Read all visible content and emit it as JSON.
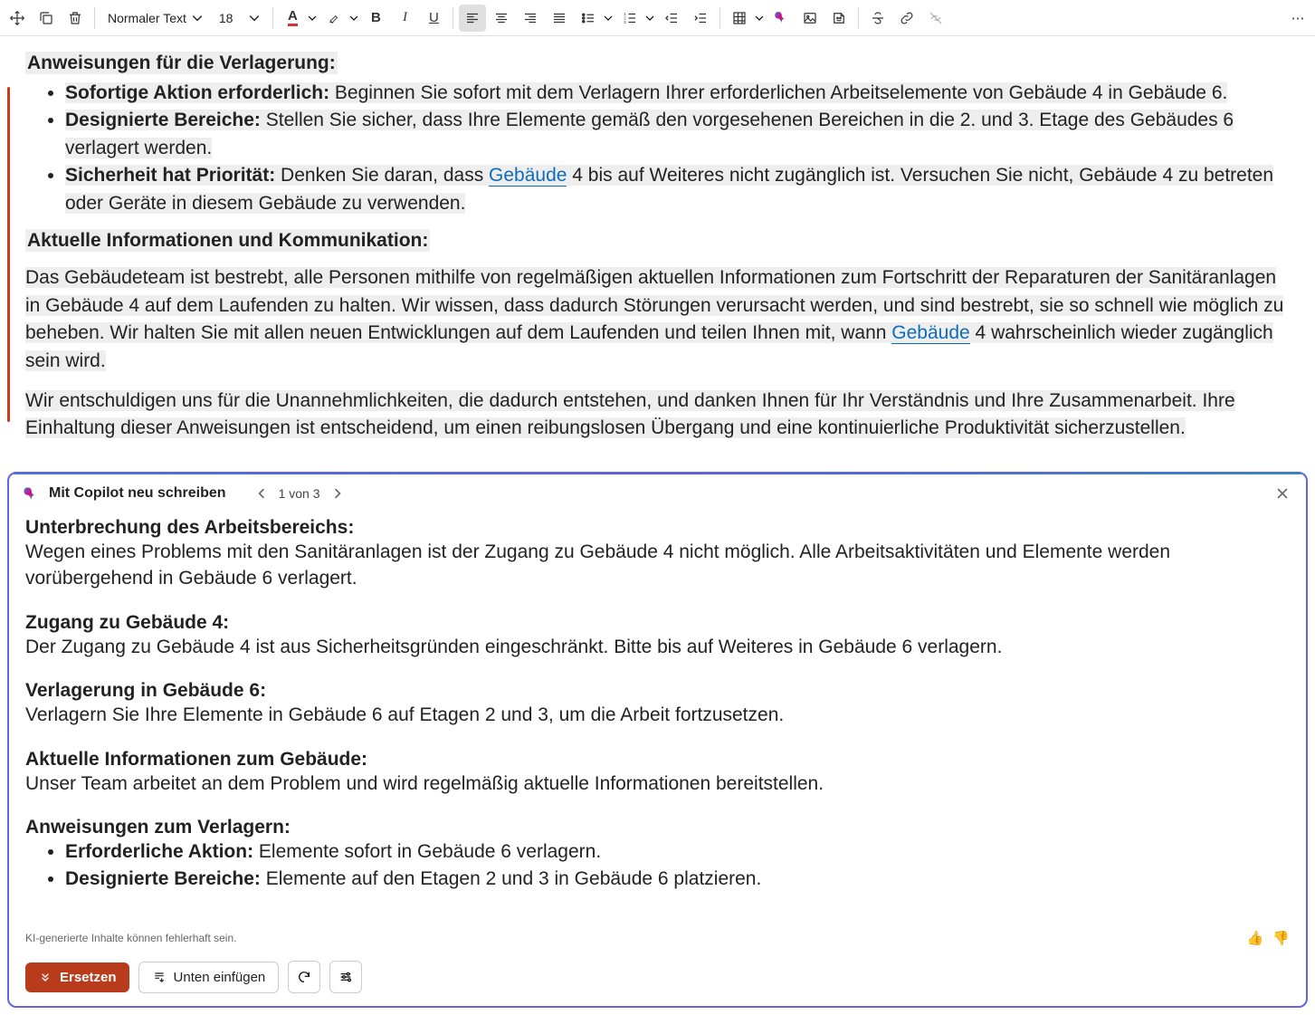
{
  "toolbar": {
    "style_select": "Normaler Text",
    "font_size": "18",
    "font_color_letter": "A"
  },
  "document": {
    "h1": "Anweisungen für die Verlagerung:",
    "li1_b": "Sofortige Aktion erforderlich:",
    "li1_t": " Beginnen Sie sofort mit dem Verlagern Ihrer erforderlichen Arbeitselemente von Gebäude 4 in Gebäude 6.",
    "li2_b": "Designierte Bereiche:",
    "li2_t": " Stellen Sie sicher, dass Ihre Elemente gemäß den vorgesehenen Bereichen in die 2. und 3. Etage des Gebäudes 6 verlagert werden.",
    "li3_b": "Sicherheit hat Priorität:",
    "li3_t1": " Denken Sie daran, dass ",
    "li3_link": "Gebäude",
    "li3_t2": " 4 bis auf Weiteres nicht zugänglich ist. Versuchen Sie nicht, Gebäude 4 zu betreten oder Geräte in diesem Gebäude zu verwenden.",
    "h2": "Aktuelle Informationen und Kommunikation:",
    "p1_a": "Das Gebäudeteam ist bestrebt, alle Personen mithilfe von regelmäßigen aktuellen Informationen zum Fortschritt der Reparaturen der Sanitäranlagen in Gebäude 4 auf dem Laufenden zu halten. Wir wissen, dass dadurch Störungen verursacht werden, und sind bestrebt, sie so schnell wie möglich zu beheben. Wir halten Sie mit allen neuen Entwicklungen auf dem Laufenden und teilen Ihnen mit, wann ",
    "p1_link": "Gebäude",
    "p1_b": " 4 wahrscheinlich wieder zugänglich sein wird.",
    "p2": "Wir entschuldigen uns für die Unannehmlichkeiten, die dadurch entstehen, und danken Ihnen für Ihr Verständnis und Ihre Zusammenarbeit. Ihre Einhaltung dieser Anweisungen ist entscheidend, um einen reibungslosen Übergang und eine kontinuierliche Produktivität sicherzustellen."
  },
  "copilot": {
    "title": "Mit Copilot neu schreiben",
    "counter": "1 von 3",
    "sections": {
      "s1_h": "Unterbrechung des Arbeitsbereichs:",
      "s1_p": "Wegen eines Problems mit den Sanitäranlagen ist der Zugang zu Gebäude 4 nicht möglich. Alle Arbeitsaktivitäten und Elemente werden vorübergehend in Gebäude 6 verlagert.",
      "s2_h": "Zugang zu Gebäude 4:",
      "s2_p": "Der Zugang zu Gebäude 4 ist aus Sicherheitsgründen eingeschränkt. Bitte bis auf Weiteres in Gebäude 6 verlagern.",
      "s3_h": "Verlagerung in Gebäude 6:",
      "s3_p": "Verlagern Sie Ihre Elemente in Gebäude 6 auf Etagen 2 und 3, um die Arbeit fortzusetzen.",
      "s4_h": "Aktuelle Informationen zum Gebäude:",
      "s4_p": "Unser Team arbeitet an dem Problem und wird regelmäßig aktuelle Informationen bereitstellen.",
      "s5_h": "Anweisungen zum Verlagern:",
      "s5_li1_b": "Erforderliche Aktion:",
      "s5_li1_t": " Elemente sofort in Gebäude 6 verlagern.",
      "s5_li2_b": "Designierte Bereiche:",
      "s5_li2_t": " Elemente auf den Etagen 2 und 3 in Gebäude 6 platzieren."
    },
    "footer_note": "KI-generierte Inhalte können fehlerhaft sein.",
    "btn_replace": "Ersetzen",
    "btn_insert": "Unten einfügen"
  }
}
